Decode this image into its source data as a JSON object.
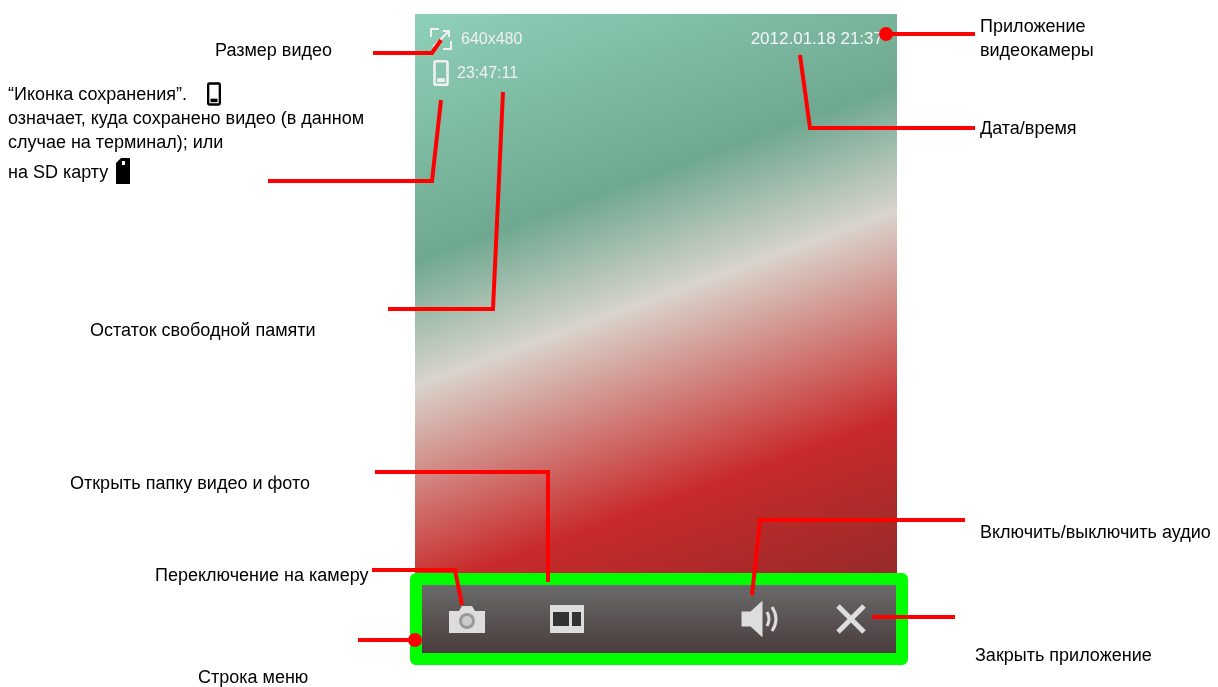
{
  "screen": {
    "resolution": "640x480",
    "remaining_time": "23:47:11",
    "datetime": "2012.01.18 21:37"
  },
  "callouts": [
    {
      "text": "Размер видео"
    },
    {
      "text": "Остаток свободной памяти"
    },
    {
      "text": "Открыть папку видео и фото"
    },
    {
      "text": "Переключение на камеру"
    },
    {
      "text": "Строка меню"
    },
    {
      "text": "Приложение видеокамеры"
    },
    {
      "text": "Дата/время"
    },
    {
      "text": "Включить/выключить аудио"
    },
    {
      "text": "Закрыть приложение"
    }
  ],
  "save_note": {
    "title": "“Иконка сохранения”.",
    "body": "означает, куда сохранено видео (в данном случае на терминал); или",
    "sd": "на SD карту"
  }
}
